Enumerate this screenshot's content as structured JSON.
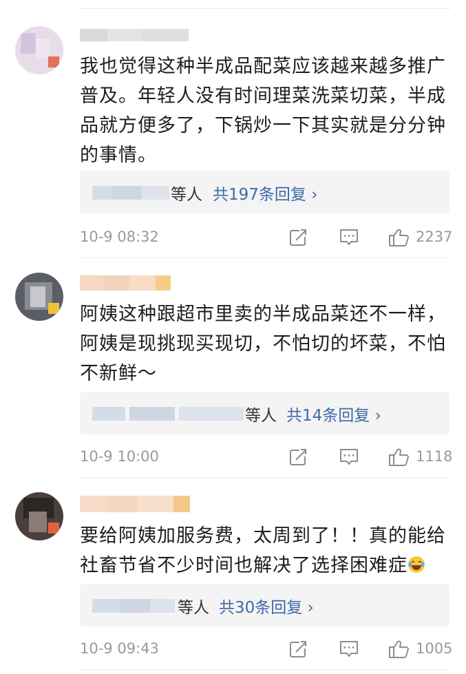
{
  "comments": [
    {
      "text": "我也觉得这种半成品配菜应该越来越多推广普及。年轻人没有时间理菜洗菜切菜，半成品就方便多了，下锅炒一下其实就是分分钟的事情。",
      "replies_suffix": "等人",
      "replies_count": "共197条回复 ›",
      "time": "10-9 08:32",
      "likes": "2237"
    },
    {
      "text": "阿姨这种跟超市里卖的半成品菜还不一样，阿姨是现挑现买现切，不怕切的坏菜，不怕不新鲜～",
      "replies_suffix": "等人",
      "replies_count": "共14条回复 ›",
      "time": "10-9 10:00",
      "likes": "1118"
    },
    {
      "text": "要给阿姨加服务费，太周到了！！真的能给社畜节省不少时间也解决了选择困难症",
      "replies_suffix": "等人",
      "replies_count": "共30条回复 ›",
      "time": "10-9 09:43",
      "likes": "1005"
    }
  ],
  "icons": {
    "share": "share-icon",
    "comment": "comment-icon",
    "like": "thumbs-up-icon",
    "emoji": "laughing-tears-emoji"
  },
  "colors": {
    "link": "#3b6aa8",
    "meta": "#999999",
    "reply_bg": "#f4f4f4"
  }
}
